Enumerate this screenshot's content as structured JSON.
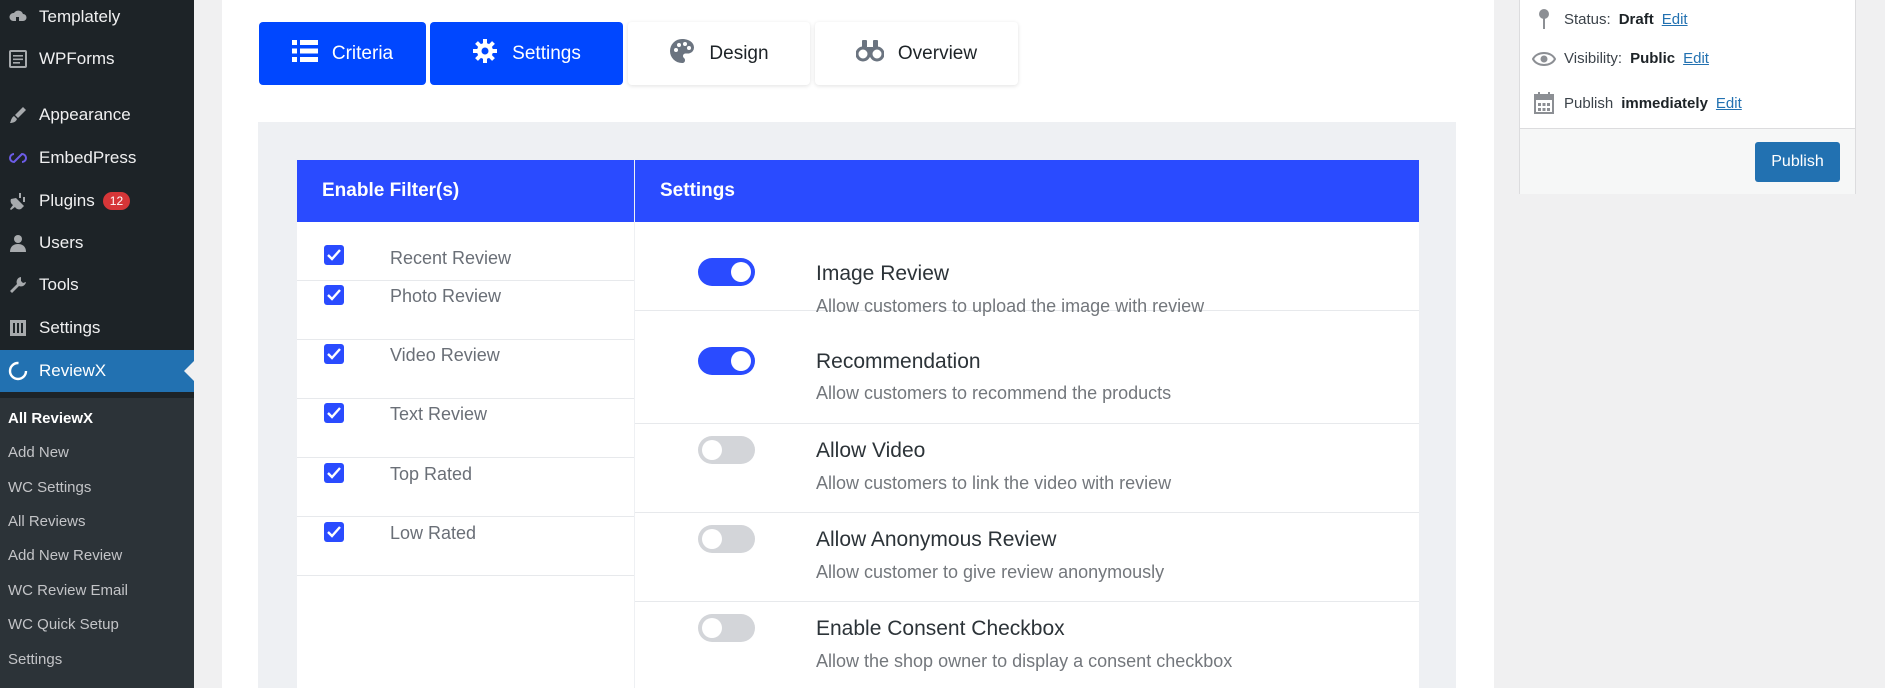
{
  "sidebar": {
    "items": [
      {
        "label": "Templately"
      },
      {
        "label": "WPForms"
      },
      {
        "label": "Appearance"
      },
      {
        "label": "EmbedPress"
      },
      {
        "label": "Plugins",
        "badge": "12"
      },
      {
        "label": "Users"
      },
      {
        "label": "Tools"
      },
      {
        "label": "Settings"
      },
      {
        "label": "ReviewX"
      }
    ],
    "submenu": [
      {
        "label": "All ReviewX"
      },
      {
        "label": "Add New"
      },
      {
        "label": "WC Settings"
      },
      {
        "label": "All Reviews"
      },
      {
        "label": "Add New Review"
      },
      {
        "label": "WC Review Email"
      },
      {
        "label": "WC Quick Setup"
      },
      {
        "label": "Settings"
      }
    ]
  },
  "tabs": [
    {
      "label": "Criteria",
      "icon": "list-icon"
    },
    {
      "label": "Settings",
      "icon": "gear-icon"
    },
    {
      "label": "Design",
      "icon": "palette-icon"
    },
    {
      "label": "Overview",
      "icon": "binoculars-icon"
    }
  ],
  "filters": {
    "header": "Enable Filter(s)",
    "items": [
      {
        "label": "Recent Review",
        "checked": true
      },
      {
        "label": "Photo Review",
        "checked": true
      },
      {
        "label": "Video Review",
        "checked": true
      },
      {
        "label": "Text Review",
        "checked": true
      },
      {
        "label": "Top Rated",
        "checked": true
      },
      {
        "label": "Low Rated",
        "checked": true
      }
    ]
  },
  "settings": {
    "header": "Settings",
    "items": [
      {
        "title": "Image Review",
        "desc": "Allow customers to upload the image with review",
        "enabled": true
      },
      {
        "title": "Recommendation",
        "desc": "Allow customers to recommend the products",
        "enabled": true
      },
      {
        "title": "Allow Video",
        "desc": "Allow customers to link the video with review",
        "enabled": false
      },
      {
        "title": "Allow Anonymous Review",
        "desc": "Allow customer to give review anonymously",
        "enabled": false
      },
      {
        "title": "Enable Consent Checkbox",
        "desc": "Allow the shop owner to display a consent checkbox",
        "enabled": false
      }
    ]
  },
  "publish": {
    "status_label": "Status:",
    "status_value": "Draft",
    "visibility_label": "Visibility:",
    "visibility_value": "Public",
    "publish_label": "Publish",
    "publish_value": "immediately",
    "edit_label": "Edit",
    "button_label": "Publish"
  },
  "colors": {
    "accent": "#0047ff",
    "header_blue": "#2a4bff",
    "wp_blue": "#2271b1",
    "sidebar_bg": "#1d2327"
  }
}
